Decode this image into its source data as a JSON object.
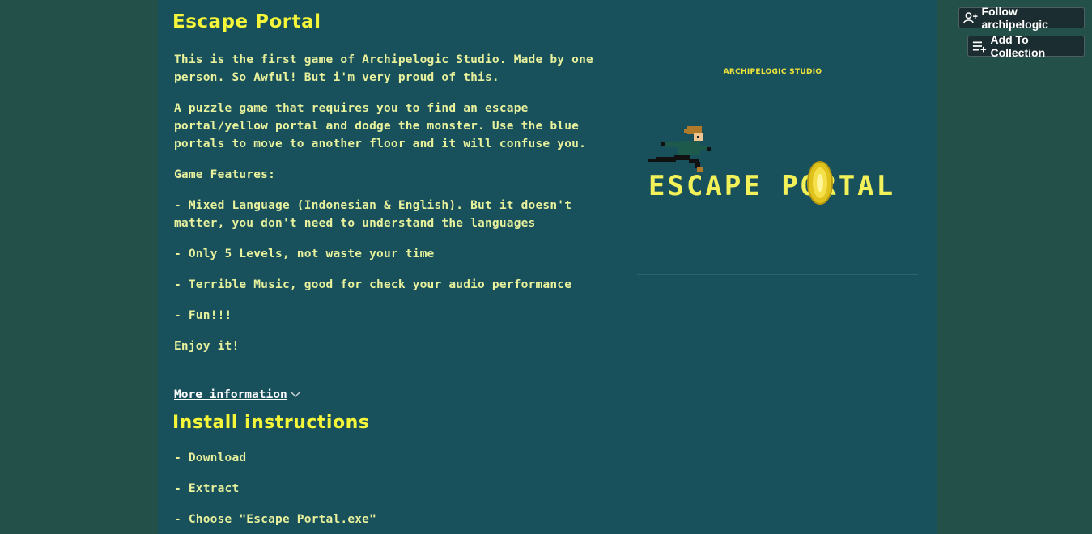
{
  "game": {
    "title": "Escape Portal",
    "description": [
      "This is the first game of Archipelogic Studio. Made by one person. So Awful! But i'm very proud of this.",
      "A puzzle game that requires you to find an escape portal/yellow portal and dodge the monster. Use the blue portals to move to another floor and it will confuse you.",
      "Game Features:",
      "- Mixed Language (Indonesian & English). But it doesn't matter, you don't need to understand the languages",
      "- Only 5 Levels, not waste your time",
      "- Terrible Music, good for check your audio performance",
      "- Fun!!!",
      "Enjoy it!"
    ],
    "more_info_label": "More information"
  },
  "install": {
    "title": "Install instructions",
    "steps": [
      "- Download",
      "- Extract",
      "- Choose \"Escape Portal.exe\""
    ]
  },
  "sidebar": {
    "studio_label": "ARCHIPELOGIC STUDIO",
    "logo_text": "ESCAPE PORTAL"
  },
  "header_buttons": {
    "follow_label": "Follow archipelogic",
    "collection_label": "Add To Collection"
  },
  "colors": {
    "page_bg": "#23514a",
    "content_bg": "#18505c",
    "title_yellow": "#f5f53a",
    "body_text": "#e8f19c"
  }
}
